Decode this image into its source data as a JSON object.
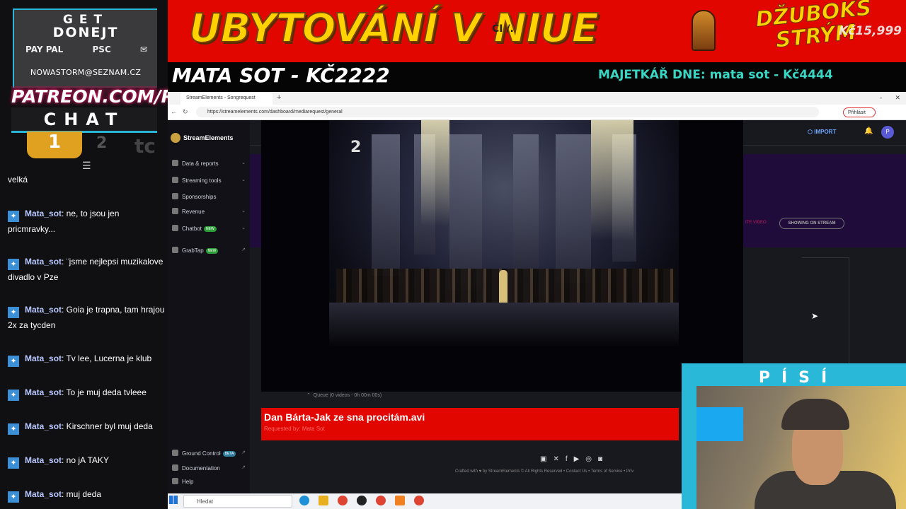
{
  "overlay": {
    "donate_title_1": "GET",
    "donate_title_2": "DONEJT",
    "pay1": "PAY PAL",
    "pay2": "PSC",
    "email": "NOWASTORM@SEZNAM.CZ",
    "patreon": "PATREON.COM/PISI",
    "chat_label": "CHAT",
    "badge1": "1",
    "badge2": "2",
    "badge3": "tc"
  },
  "chat": {
    "messages": [
      {
        "user": "",
        "text": "velká"
      },
      {
        "user": "Mata_sot",
        "text": ": ne, to jsou jen pricmravky..."
      },
      {
        "user": "Mata_sot",
        "text": ": ¨jsme nejlepsi muzikalove divadlo v Pze"
      },
      {
        "user": "Mata_sot",
        "text": ": Goia je trapna, tam hrajou 2x za tycden"
      },
      {
        "user": "Mata_sot",
        "text": ": Tv lee, Lucerna je klub"
      },
      {
        "user": "Mata_sot",
        "text": ": To je muj deda tvleee"
      },
      {
        "user": "Mata_sot",
        "text": ": Kirschner byl muj deda"
      },
      {
        "user": "Mata_sot",
        "text": ": no jA TAKY"
      },
      {
        "user": "Mata_sot",
        "text": ": muj deda"
      }
    ]
  },
  "banner": {
    "title": "UBYTOVÁNÍ V NIUE",
    "small": "ČI /.",
    "jukebox": "DŽUBOKS STRÝM",
    "price": "Kč15,999",
    "left_strip": "MATA SOT - KČ2222",
    "right_strip": "MAJETKÁŘ DNE: mata sot - Kč4444"
  },
  "browser": {
    "tab_title": "StreamElements - Songrequest",
    "url": "https://streamelements.com/dashboard/mediarequest/general",
    "signin": "Přihlásit"
  },
  "se": {
    "brand": "StreamElements",
    "nav": [
      "Data & reports",
      "Streaming tools",
      "Sponsorships",
      "Revenue",
      "Chatbot",
      "GrabTap"
    ],
    "new_tag": "NEW",
    "beta_tag": "BETA",
    "bottom_nav": [
      "Ground Control",
      "Documentation",
      "Help"
    ],
    "import": "IMPORT",
    "avatar": "P",
    "showing_btn": "SHOWING ON STREAM",
    "hint": "ITE VIDEO",
    "video_number": "2",
    "queue": "Queue (0 videos - 0h 00m 00s)",
    "now_playing": "Dan Bárta-Jak ze sna procitám.avi",
    "requested_by": "Requested by: Mata Sot",
    "footer": "Crafted with ♥ by StreamElements © All Rights Reserved • Contact Us • Terms of Service • Priv"
  },
  "taskbar": {
    "search": "Hledat"
  },
  "webcam": {
    "label": "PÍSÍ"
  },
  "colors": {
    "banner_red": "#e10600",
    "accent_cyan": "#29b6d6",
    "se_purple": "#1f0c3a"
  }
}
